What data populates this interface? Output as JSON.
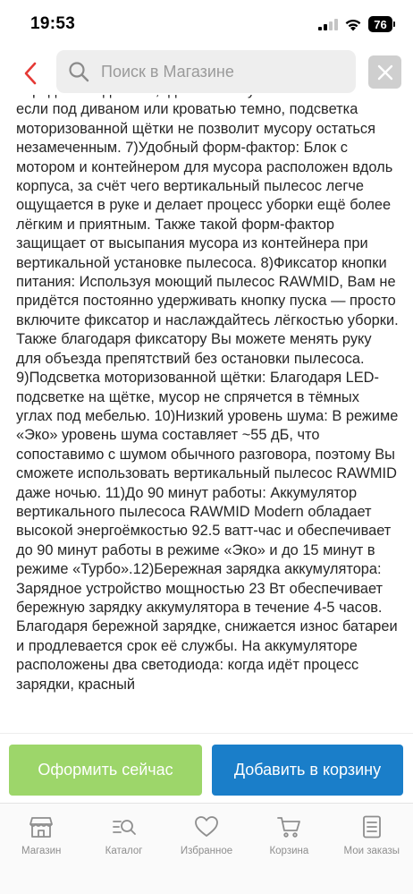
{
  "status_bar": {
    "time": "19:53",
    "battery_level": "76"
  },
  "header": {
    "search_placeholder": "Поиск в Магазине",
    "icons": {
      "back": "chevron-left-icon",
      "search": "search-icon",
      "close": "close-icon"
    },
    "colors": {
      "back_arrow": "#e53935",
      "close_bg": "#cfcfcf"
    }
  },
  "content": {
    "description": "переднем подсветки, где нельзя нужно нагибаться. А если под диваном или кроватью темно, подсветка моторизованной щётки не позволит мусору остаться незамеченным. 7)Удобный форм-фактор: Блок с мотором и контейнером для мусора расположен вдоль корпуса, за счёт чего вертикальный пылесос легче ощущается в руке и делает процесс уборки ещё более лёгким и приятным. Также такой форм-фактор защищает от высыпания мусора из контейнера при вертикальной установке пылесоса. 8)Фиксатор кнопки питания: Используя моющий пылесос RAWMID, Вам не придётся постоянно удерживать кнопку пуска — просто включите фиксатор и наслаждайтесь лёгкостью уборки. Также благодаря фиксатору Вы можете менять руку для объезда препятствий без остановки пылесоса. 9)Подсветка моторизованной щётки: Благодаря LED-подсветке на щётке, мусор не спрячется в тёмных углах под мебелью. 10)Низкий уровень шума: В режиме «Эко» уровень шума составляет ~55 дБ, что сопоставимо с шумом обычного разговора, поэтому Вы сможете использовать вертикальный пылесос RAWMID даже ночью. 11)До 90 минут работы: Аккумулятор вертикального пылесоса RAWMID Modern обладает высокой энергоёмкостью 92.5 ватт-час и обеспечивает до 90 минут работы в режиме «Эко» и до 15 минут в режиме «Турбо».12)Бережная зарядка аккумулятора: Зарядное устройство мощностью 23 Вт обеспечивает бережную зарядку аккумулятора в течение 4-5 часов. Благодаря бережной зарядке, снижается износ батареи и продлевается срок её службы. На аккумуляторе расположены два светодиода: когда идёт процесс зарядки, красный"
  },
  "actions": {
    "checkout_label": "Оформить сейчас",
    "add_to_cart_label": "Добавить в корзину",
    "colors": {
      "checkout": "#9dd66a",
      "add_to_cart": "#1a7ec9"
    }
  },
  "tab_bar": {
    "items": [
      {
        "label": "Магазин",
        "icon": "store-icon"
      },
      {
        "label": "Каталог",
        "icon": "catalog-search-icon"
      },
      {
        "label": "Избранное",
        "icon": "heart-icon"
      },
      {
        "label": "Корзина",
        "icon": "cart-icon"
      },
      {
        "label": "Мои заказы",
        "icon": "orders-icon"
      }
    ],
    "colors": {
      "icon": "#8e8e8e"
    }
  }
}
